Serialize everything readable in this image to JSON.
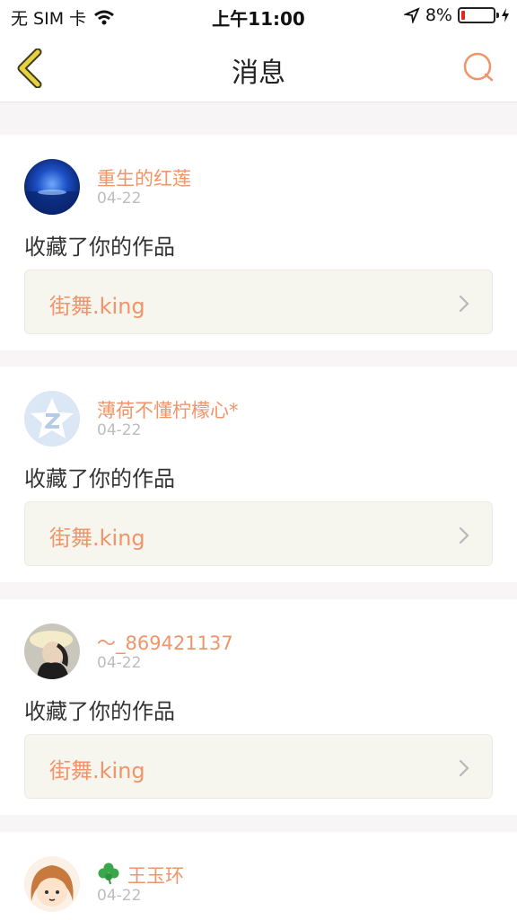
{
  "status": {
    "carrier": "无 SIM 卡",
    "time": "上午11:00",
    "battery": "8%"
  },
  "nav": {
    "title": "消息"
  },
  "messages": [
    {
      "user": "重生的红莲",
      "date": "04-22",
      "action": "收藏了你的作品",
      "work": "街舞.king"
    },
    {
      "user": "薄荷不懂柠檬心*",
      "date": "04-22",
      "action": "收藏了你的作品",
      "work": "街舞.king"
    },
    {
      "user": "～_869421137",
      "date": "04-22",
      "action": "收藏了你的作品",
      "work": "街舞.king"
    },
    {
      "user": "王玉环",
      "date": "04-22"
    }
  ],
  "colors": {
    "accent": "#f0946a",
    "back": "#e8d040",
    "battery_low": "#e0281e"
  }
}
